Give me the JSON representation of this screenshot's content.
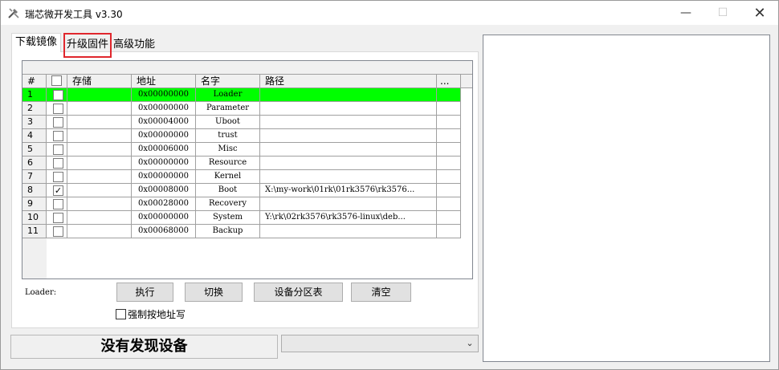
{
  "window": {
    "title": "瑞芯微开发工具 v3.30",
    "minimize_glyph": "—",
    "maximize_glyph": "☐",
    "close_glyph": "✕"
  },
  "tabs": [
    {
      "label": "下载镜像"
    },
    {
      "label": "升级固件"
    },
    {
      "label": "高级功能"
    }
  ],
  "grid": {
    "headers": [
      "#",
      "",
      "存储",
      "地址",
      "名字",
      "路径",
      "..."
    ],
    "rows": [
      {
        "num": "1",
        "checked": "",
        "storage": "",
        "address": "0x00000000",
        "name": "Loader",
        "path": ""
      },
      {
        "num": "2",
        "checked": "",
        "storage": "",
        "address": "0x00000000",
        "name": "Parameter",
        "path": ""
      },
      {
        "num": "3",
        "checked": "",
        "storage": "",
        "address": "0x00004000",
        "name": "Uboot",
        "path": ""
      },
      {
        "num": "4",
        "checked": "",
        "storage": "",
        "address": "0x00000000",
        "name": "trust",
        "path": ""
      },
      {
        "num": "5",
        "checked": "",
        "storage": "",
        "address": "0x00006000",
        "name": "Misc",
        "path": ""
      },
      {
        "num": "6",
        "checked": "",
        "storage": "",
        "address": "0x00000000",
        "name": "Resource",
        "path": ""
      },
      {
        "num": "7",
        "checked": "",
        "storage": "",
        "address": "0x00000000",
        "name": "Kernel",
        "path": ""
      },
      {
        "num": "8",
        "checked": "✓",
        "storage": "",
        "address": "0x00008000",
        "name": "Boot",
        "path": "X:\\my-work\\01rk\\01rk3576\\rk3576..."
      },
      {
        "num": "9",
        "checked": "",
        "storage": "",
        "address": "0x00028000",
        "name": "Recovery",
        "path": ""
      },
      {
        "num": "10",
        "checked": "",
        "storage": "",
        "address": "0x00000000",
        "name": "System",
        "path": "Y:\\rk\\02rk3576\\rk3576-linux\\deb..."
      },
      {
        "num": "11",
        "checked": "",
        "storage": "",
        "address": "0x00068000",
        "name": "Backup",
        "path": ""
      }
    ],
    "selected_row_color": "#00ff00"
  },
  "controls": {
    "loader_label": "Loader:",
    "exec_button": "执行",
    "switch_button": "切换",
    "partition_button": "设备分区表",
    "clear_button": "清空",
    "force_write_label": "强制按地址写"
  },
  "status": {
    "device_status": "没有发现设备",
    "combo_value": "",
    "combo_arrow": "⌄"
  }
}
